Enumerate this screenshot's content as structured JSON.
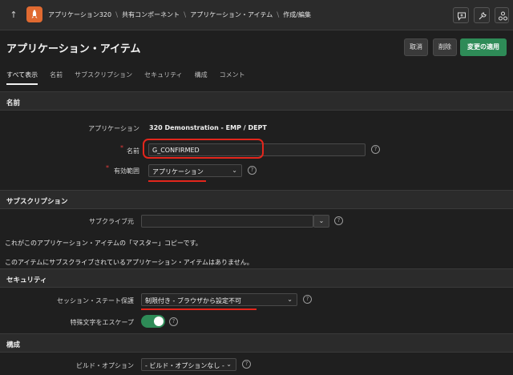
{
  "breadcrumb": {
    "items": [
      "アプリケーション320",
      "共有コンポーネント",
      "アプリケーション・アイテム",
      "作成/編集"
    ]
  },
  "page": {
    "title": "アプリケーション・アイテム"
  },
  "buttons": {
    "cancel": "取消",
    "delete": "削除",
    "apply": "変更の適用"
  },
  "tabs": [
    "すべて表示",
    "名前",
    "サブスクリプション",
    "セキュリティ",
    "構成",
    "コメント"
  ],
  "sections": {
    "name": {
      "heading": "名前",
      "application_label": "アプリケーション",
      "application_value": "320 Demonstration - EMP / DEPT",
      "name_label": "名前",
      "name_value": "G_CONFIRMED",
      "scope_label": "有効範囲",
      "scope_value": "アプリケーション"
    },
    "subscription": {
      "heading": "サブスクリプション",
      "subscribe_from_label": "サブクライブ元",
      "subscribe_from_value": "",
      "master_note": "これがこのアプリケーション・アイテムの「マスター」コピーです。",
      "no_subscribers_note": "このアイテムにサブスクライブされているアプリケーション・アイテムはありません。"
    },
    "security": {
      "heading": "セキュリティ",
      "protection_label": "セッション・ステート保護",
      "protection_value": "制限付き - ブラウザから設定不可",
      "escape_label": "特殊文字をエスケープ",
      "escape_on": true
    },
    "config": {
      "heading": "構成",
      "build_option_label": "ビルド・オプション",
      "build_option_value": "- ビルド・オプションなし -"
    }
  },
  "help_glyph": "?",
  "colors": {
    "accent_orange": "#e06a31",
    "apply_green": "#2e8b57",
    "annotation_red": "#e3261c"
  }
}
